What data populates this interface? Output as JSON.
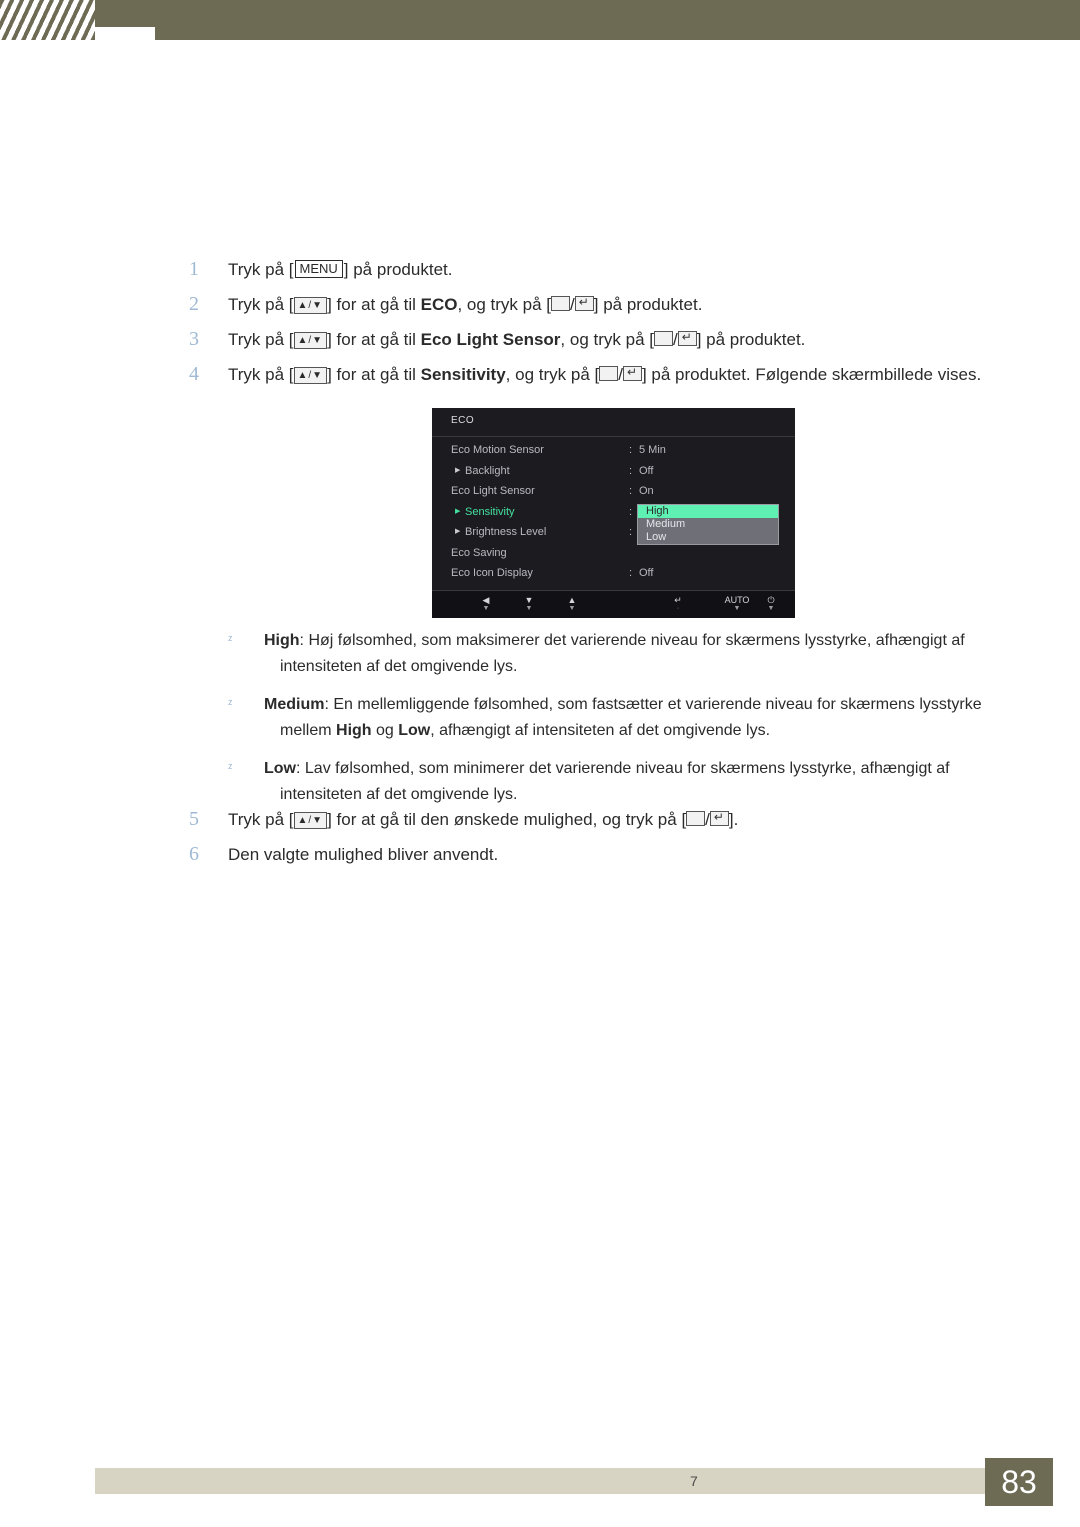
{
  "page": {
    "number": "83",
    "footer_page_label": "7"
  },
  "steps_head": [
    {
      "num": "1",
      "pre": "Tryk på [",
      "key": "MENU",
      "post": "] på produktet."
    },
    {
      "num": "2",
      "pre": "Tryk på [",
      "key": "▲/▼",
      "mid": "] for at gå til ",
      "bold": "ECO",
      "post": ", og tryk på [",
      "post2": "] på produktet."
    },
    {
      "num": "3",
      "pre": "Tryk på [",
      "key": "▲/▼",
      "mid": "] for at gå til ",
      "bold": "Eco Light Sensor",
      "post": ", og tryk på [",
      "post2": "] på produktet."
    },
    {
      "num": "4",
      "pre": "Tryk på [",
      "key": "▲/▼",
      "mid": "] for at gå til ",
      "bold": "Sensitivity",
      "post": ", og tryk på [",
      "post2": "] på produktet. Følgende skærmbillede vises."
    }
  ],
  "osd": {
    "title": "ECO",
    "rows": [
      {
        "label": "Eco Motion Sensor",
        "arrow": false,
        "value": "5 Min"
      },
      {
        "label": "Backlight",
        "arrow": true,
        "value": "Off"
      },
      {
        "label": "Eco Light Sensor",
        "arrow": false,
        "value": "On"
      },
      {
        "label": "Sensitivity",
        "arrow": true,
        "value": ""
      },
      {
        "label": "Brightness Level",
        "arrow": true,
        "value": ""
      },
      {
        "label": "Eco Saving",
        "arrow": false,
        "value": ""
      },
      {
        "label": "Eco Icon Display",
        "arrow": false,
        "value": "Off"
      }
    ],
    "popup": {
      "items": [
        "High",
        "Medium",
        "Low"
      ],
      "selected": "High"
    },
    "footer_buttons": [
      {
        "glyph": "◀",
        "sub": "▼"
      },
      {
        "glyph": "▼",
        "sub": "▼"
      },
      {
        "glyph": "▲",
        "sub": "▼"
      },
      {
        "glyph": "↵",
        "sub": "·"
      },
      {
        "glyph": "AUTO",
        "sub": "▼"
      },
      {
        "glyph": "⏻",
        "sub": "▼"
      }
    ]
  },
  "bullets": [
    {
      "mark": "z",
      "bold": "High",
      "text": ": Høj følsomhed, som maksimerer det varierende niveau for skærmens lysstyrke, afhængigt af intensiteten af det omgivende lys."
    },
    {
      "mark": "z",
      "bold": "Medium",
      "text_a": ": En mellemliggende følsomhed, som fastsætter et varierende niveau for skærmens lysstyrke mellem ",
      "bold_b": "High",
      "text_b": " og ",
      "bold_c": "Low",
      "text_c": ", afhængigt af intensiteten af det omgivende lys."
    },
    {
      "mark": "z",
      "bold": "Low",
      "text": ": Lav følsomhed, som minimerer det varierende niveau for skærmens lysstyrke, afhængigt af intensiteten af det omgivende lys."
    }
  ],
  "steps_tail": [
    {
      "num": "5",
      "pre": "Tryk på [",
      "key": "▲/▼",
      "mid": "] for at gå til den ønskede mulighed, og tryk på [",
      "post": "]."
    },
    {
      "num": "6",
      "text": "Den valgte mulighed bliver anvendt."
    }
  ]
}
